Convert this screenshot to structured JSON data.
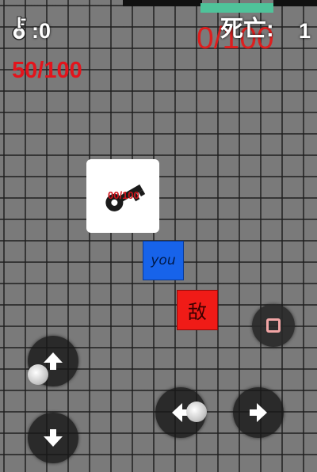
{
  "hud": {
    "key_icon": "key-icon",
    "key_count": ":0",
    "hp": "50/100",
    "progress_counter": "0/100",
    "deaths_label": "死亡:",
    "deaths_value": "1"
  },
  "items": {
    "key_item_icon": "key-icon",
    "key_item_counter": "00/100"
  },
  "player": {
    "label": "you"
  },
  "enemy": {
    "label": "敌"
  },
  "controls": {
    "up": "arrow-up-icon",
    "down": "arrow-down-icon",
    "left": "arrow-left-icon",
    "right": "arrow-right-icon",
    "action": "square-icon"
  },
  "colors": {
    "grid_background": "#7a7a7a",
    "player": "#1763ea",
    "enemy": "#f01b17",
    "hp_text": "#e3141c",
    "progress_bar": "#4fc39a"
  }
}
